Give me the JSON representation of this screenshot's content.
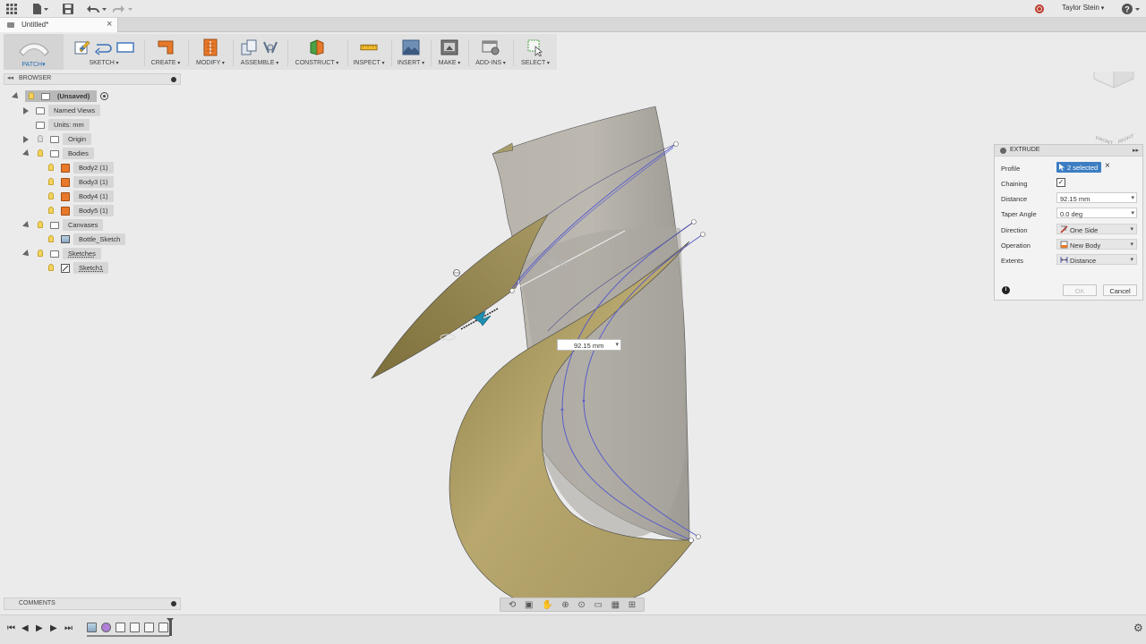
{
  "app": {
    "user": "Taylor Stein"
  },
  "doc_tab": {
    "title": "Untitled*"
  },
  "toolbar": {
    "workspace": "PATCH",
    "groups": {
      "sketch": "SKETCH",
      "create": "CREATE",
      "modify": "MODIFY",
      "assemble": "ASSEMBLE",
      "construct": "CONSTRUCT",
      "inspect": "INSPECT",
      "insert": "INSERT",
      "make": "MAKE",
      "addins": "ADD-INS",
      "select": "SELECT"
    }
  },
  "browser": {
    "title": "BROWSER",
    "root": "(Unsaved)",
    "named_views": "Named Views",
    "units": "Units: mm",
    "origin": "Origin",
    "bodies": "Bodies",
    "body_items": [
      "Body2 (1)",
      "Body3 (1)",
      "Body4 (1)",
      "Body5 (1)"
    ],
    "canvases": "Canvases",
    "canvas_item": "Bottle_Sketch",
    "sketches": "Sketches",
    "sketch_item": "Sketch1"
  },
  "comments": {
    "title": "COMMENTS"
  },
  "extrude": {
    "title": "EXTRUDE",
    "profile_label": "Profile",
    "profile_value": "2 selected",
    "chaining_label": "Chaining",
    "chaining_checked": true,
    "distance_label": "Distance",
    "distance_value": "92.15 mm",
    "taper_label": "Taper Angle",
    "taper_value": "0.0 deg",
    "direction_label": "Direction",
    "direction_value": "One Side",
    "operation_label": "Operation",
    "operation_value": "New Body",
    "extents_label": "Extents",
    "extents_value": "Distance",
    "ok_label": "OK",
    "cancel_label": "Cancel"
  },
  "viewport": {
    "dimension_input": "92.15 mm",
    "dimension_ghost": "92.15",
    "view_cube_front": "FRONT",
    "view_cube_right": "RIGHT"
  },
  "colors": {
    "surface_front": "#b6a66d",
    "surface_back": "#a8a49c",
    "sketch_line": "#5a5ec9",
    "selection_blue": "#3d7ec2",
    "manipulator": "#1f8fb1"
  }
}
